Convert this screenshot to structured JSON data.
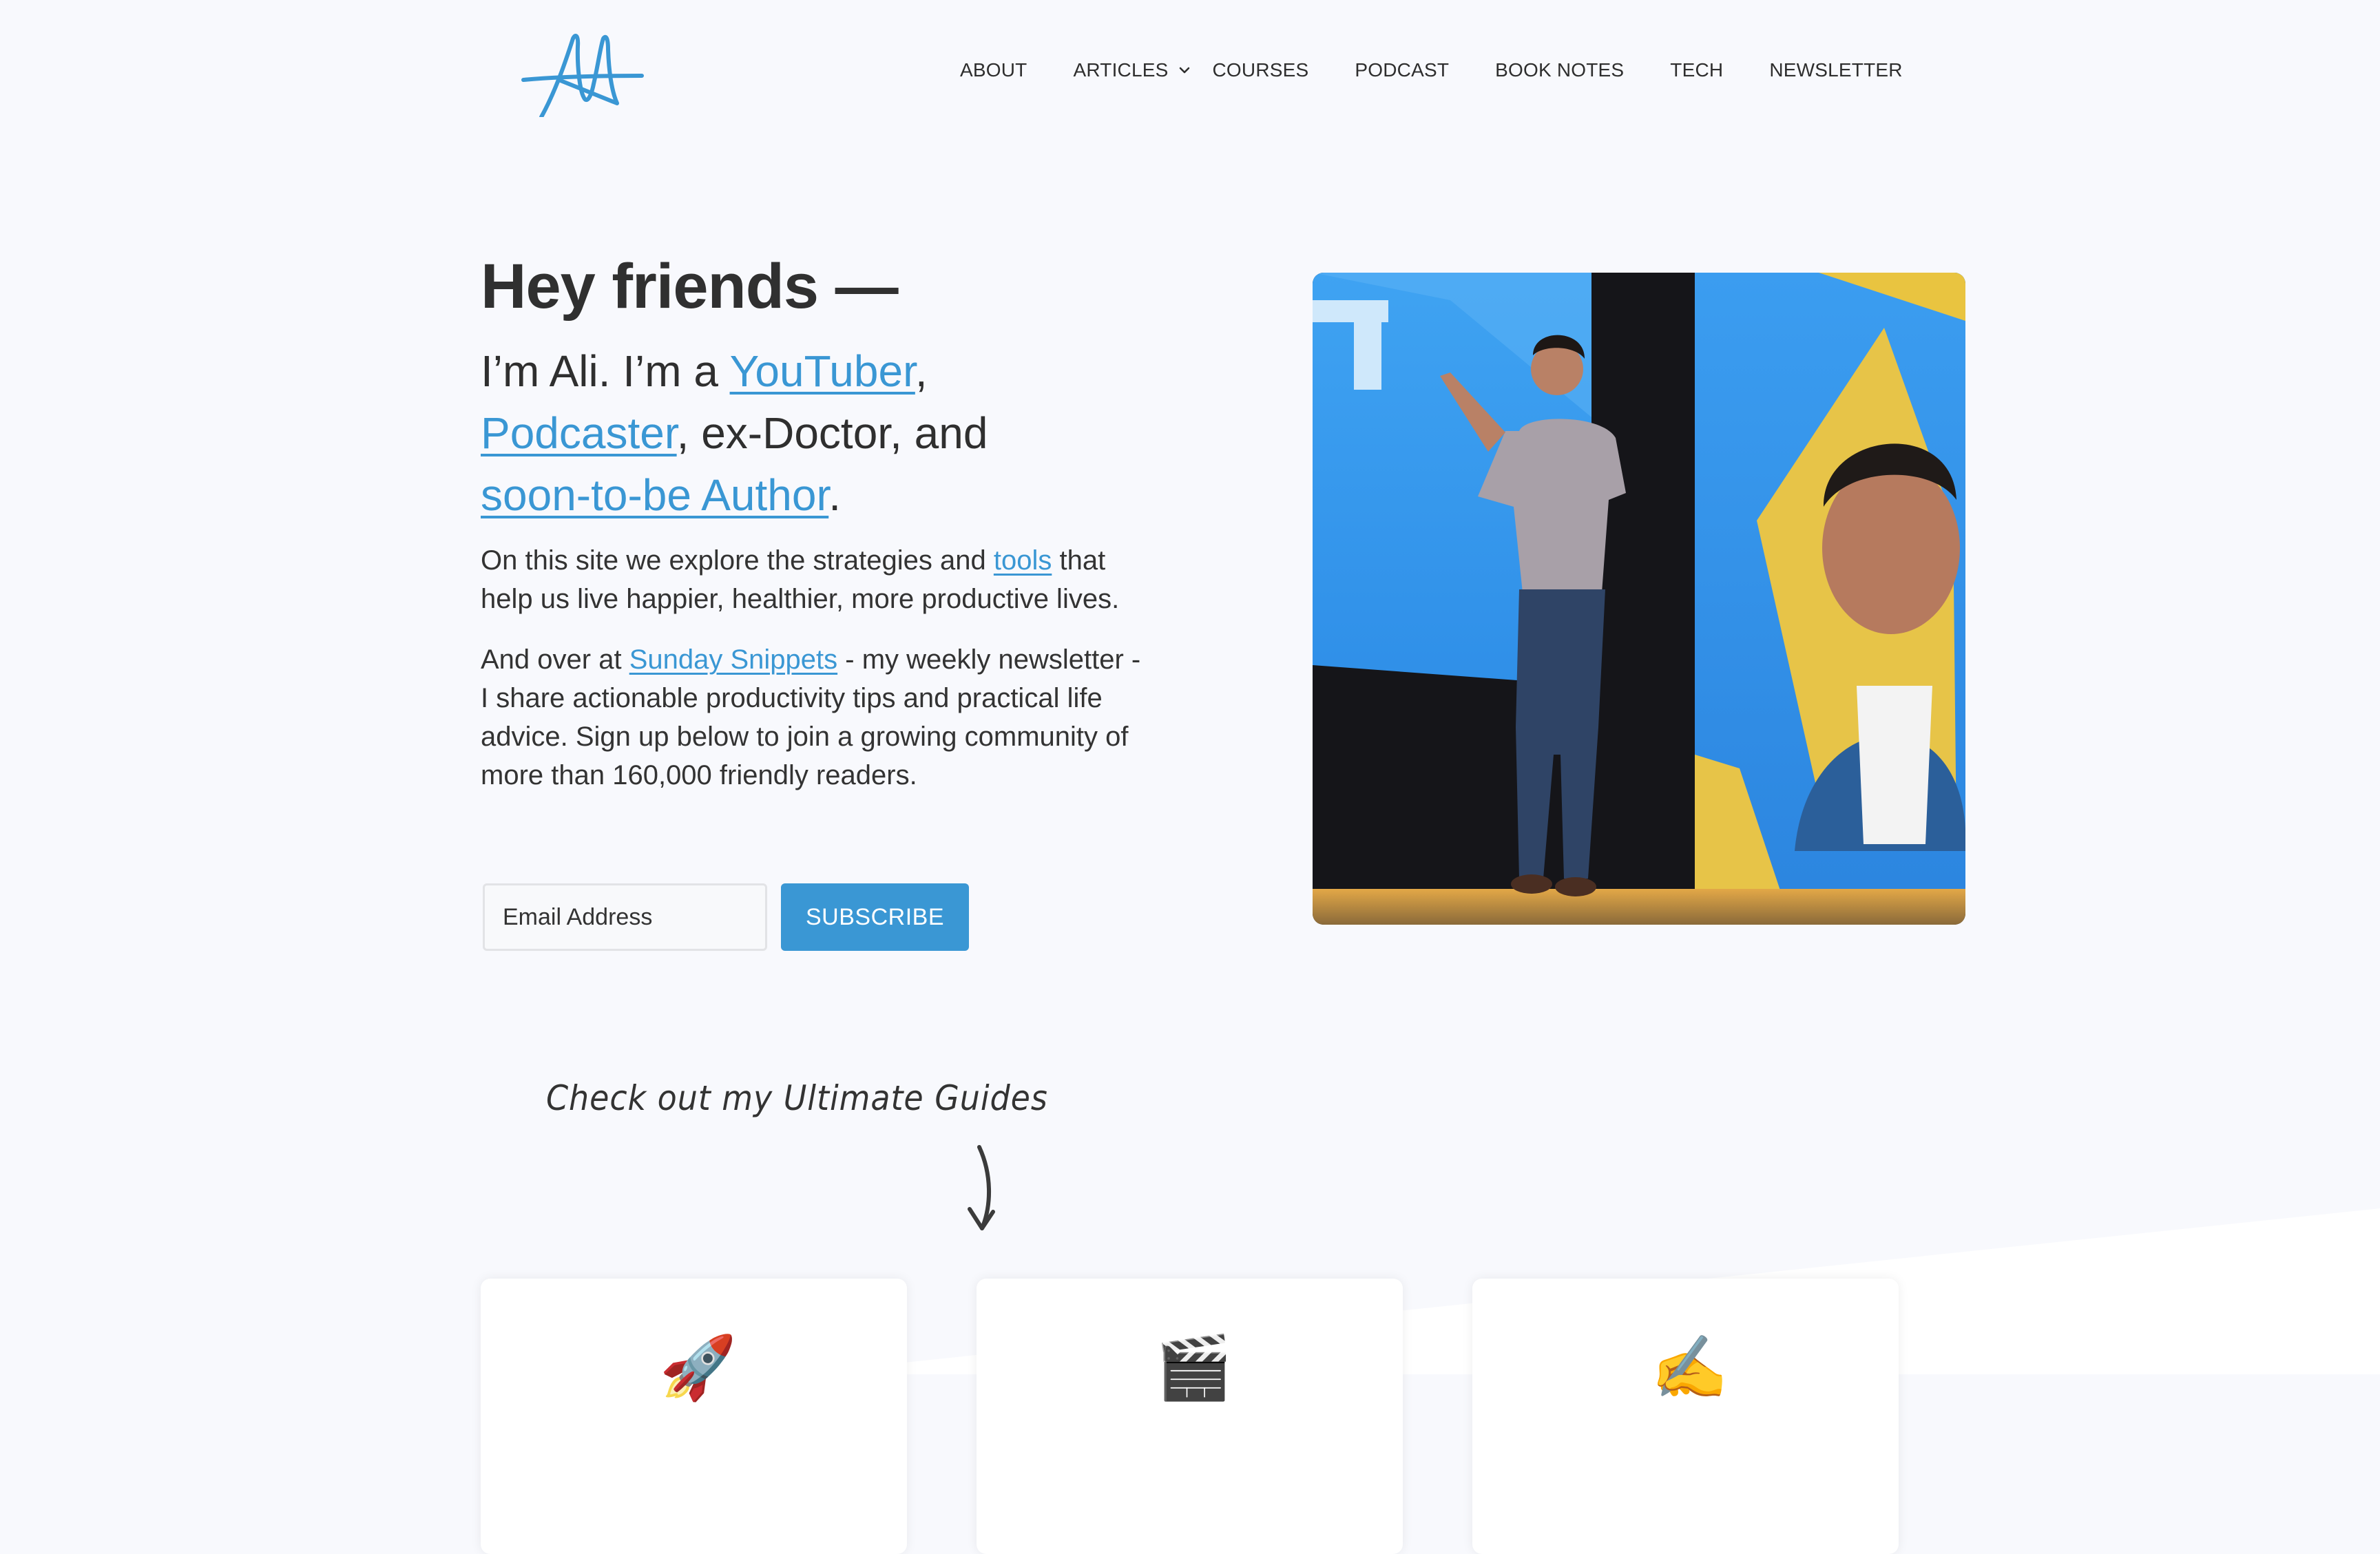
{
  "site": {
    "logo_name": "Ali Abdaal signature logo",
    "brand_color": "#3a97d4",
    "background_color": "#f8f9fd",
    "text_color": "#2f2f2f"
  },
  "nav": {
    "items": [
      {
        "label": "About",
        "has_dropdown": false
      },
      {
        "label": "Articles",
        "has_dropdown": true
      },
      {
        "label": "Courses",
        "has_dropdown": false
      },
      {
        "label": "Podcast",
        "has_dropdown": false
      },
      {
        "label": "Book Notes",
        "has_dropdown": false
      },
      {
        "label": "Tech",
        "has_dropdown": false
      },
      {
        "label": "Newsletter",
        "has_dropdown": false
      }
    ]
  },
  "hero": {
    "title": "Hey friends —",
    "intro": {
      "prefix": "I’m Ali. I’m a ",
      "link1": "YouTuber",
      "sep1": ",",
      "link2": "Podcaster",
      "middle": ", ex-Doctor, and",
      "link3": "soon-to-be Author",
      "suffix": "."
    },
    "paragraph1": {
      "before": "On this site we explore the strategies and ",
      "link": "tools",
      "after": " that help us live happier, healthier, more productive lives."
    },
    "paragraph2": {
      "before": "And over at ",
      "link": "Sunday Snippets",
      "after": " - my weekly newsletter - I share actionable productivity tips and practical life advice. Sign up below to join a growing community of more than 160,000 friendly readers."
    },
    "email_placeholder": "Email Address",
    "email_value": "",
    "subscribe_label": "SUBSCRIBE",
    "photo_alt": "Ali speaking on stage in front of a blue and yellow screen showing his portrait"
  },
  "guides": {
    "label": "Check out my Ultimate Guides",
    "cards": [
      {
        "icon": "rocket-icon",
        "glyph": "🚀",
        "title": ""
      },
      {
        "icon": "clapper-board-icon",
        "glyph": "🎬",
        "title": ""
      },
      {
        "icon": "writing-hand-icon",
        "glyph": "✍️",
        "title": ""
      }
    ]
  }
}
